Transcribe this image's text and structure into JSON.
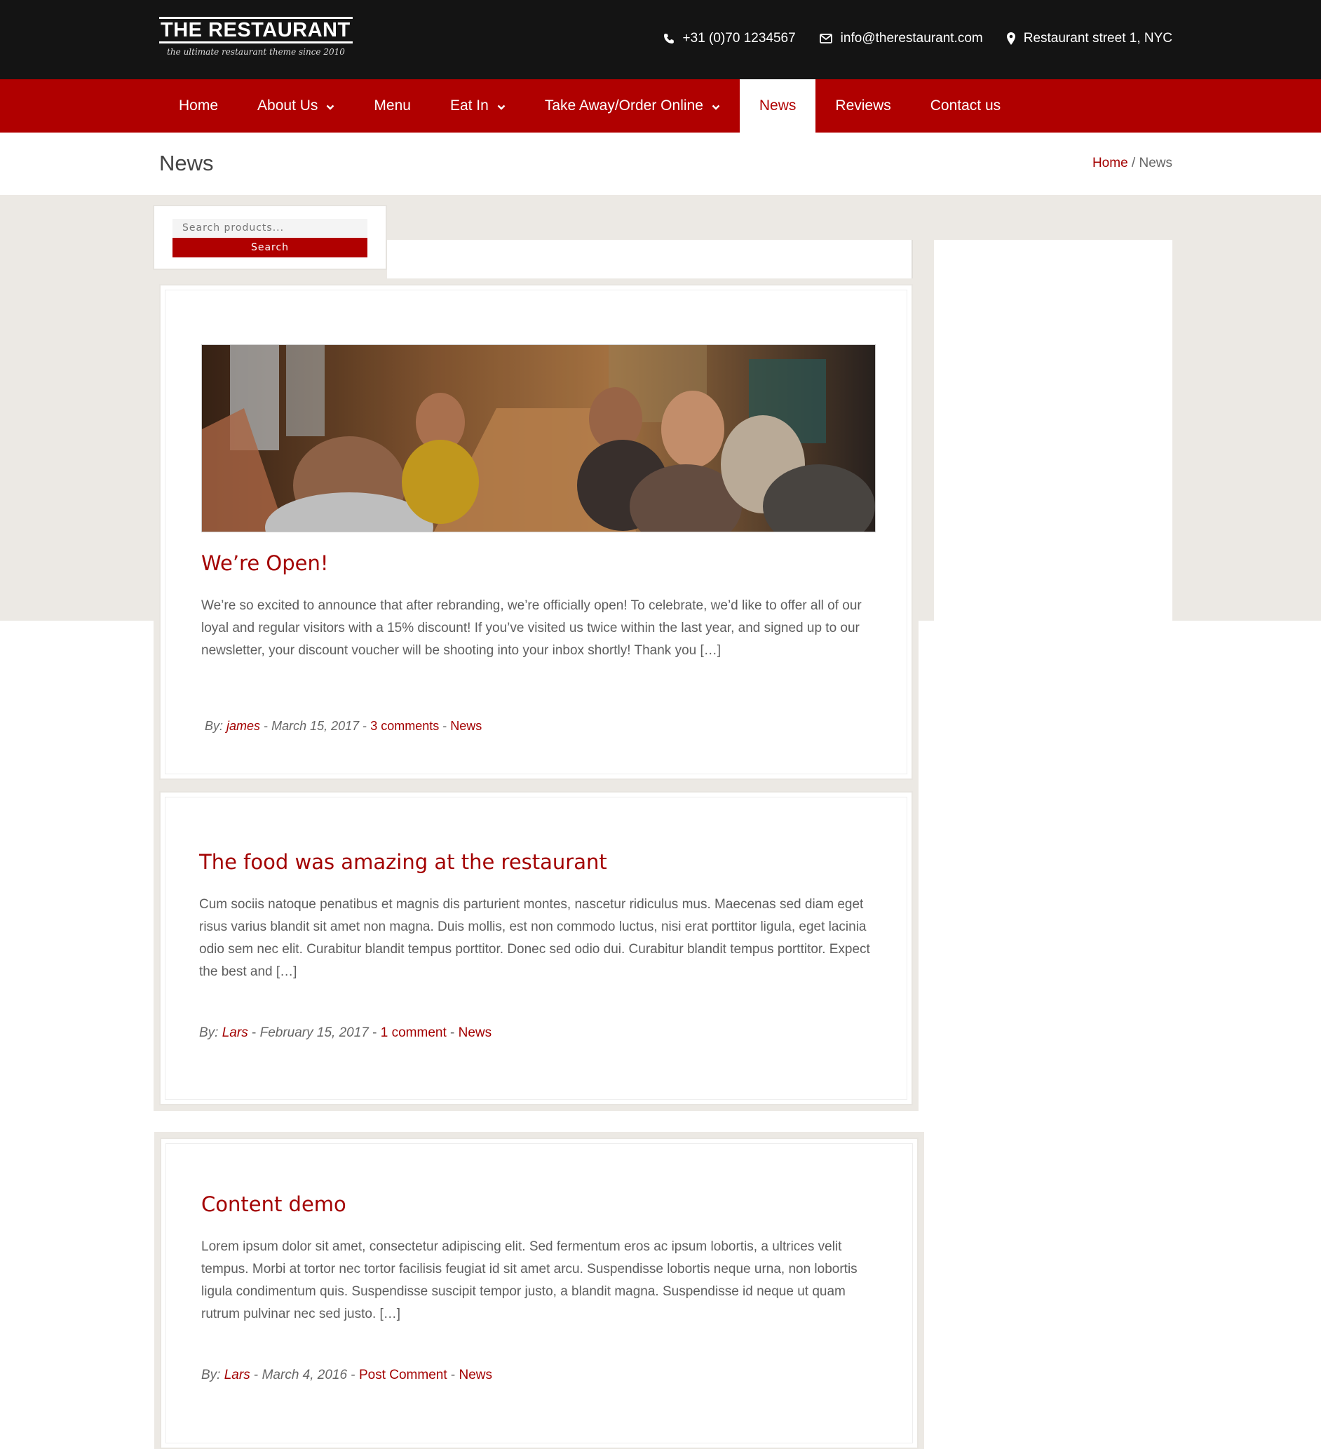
{
  "header": {
    "logo_title": "THE RESTAURANT",
    "logo_tagline": "the ultimate restaurant theme since 2010",
    "phone": "+31 (0)70 1234567",
    "email": "info@therestaurant.com",
    "address": "Restaurant street 1, NYC"
  },
  "nav": {
    "items": [
      {
        "label": "Home"
      },
      {
        "label": "About Us"
      },
      {
        "label": "Menu"
      },
      {
        "label": "Eat In"
      },
      {
        "label": "Take Away/Order Online"
      },
      {
        "label": "News"
      },
      {
        "label": "Reviews"
      },
      {
        "label": "Contact us"
      }
    ]
  },
  "page": {
    "title": "News",
    "breadcrumb_home": "Home",
    "breadcrumb_sep": "/",
    "breadcrumb_current": "News"
  },
  "search": {
    "placeholder": "Search products...",
    "button_label": "Search"
  },
  "posts": [
    {
      "title": "We’re Open!",
      "excerpt": "We’re so excited to announce that after rebranding, we’re officially open! To celebrate, we’d like to offer all of our loyal and regular visitors with a 15% discount! If you’ve visited us twice within the last year, and signed up to our newsletter, your discount voucher will be shooting into your inbox shortly! Thank you […]",
      "by_label": "By:",
      "author": "james",
      "date": "March 15, 2017",
      "comments": "3 comments",
      "category": "News"
    },
    {
      "title": "The food was amazing at the restaurant",
      "excerpt": "Cum sociis natoque penatibus et magnis dis parturient montes, nascetur ridiculus mus. Maecenas sed diam eget risus varius blandit sit amet non magna. Duis mollis, est non commodo luctus, nisi erat porttitor ligula, eget lacinia odio sem nec elit. Curabitur blandit tempus porttitor. Donec sed odio dui. Curabitur blandit tempus porttitor. Expect the best and […]",
      "by_label": "By:",
      "author": "Lars",
      "date": "February 15, 2017",
      "comments": "1 comment",
      "category": "News"
    },
    {
      "title": "Content demo",
      "excerpt": "Lorem ipsum dolor sit amet, consectetur adipiscing elit. Sed fermentum eros ac ipsum lobortis, a ultrices velit tempus. Morbi at tortor nec tortor facilisis feugiat id sit amet arcu. Suspendisse lobortis neque urna, non lobortis ligula condimentum quis. Suspendisse suscipit tempor justo, a blandit magna. Suspendisse id neque ut quam rutrum pulvinar nec sed justo. […]",
      "by_label": "By:",
      "author": "Lars",
      "date": "March 4, 2016",
      "comments": "Post Comment",
      "category": "News"
    }
  ],
  "colors": {
    "brand_red": "#b00000",
    "link_red": "#a30000",
    "topbar": "#141414",
    "band": "#ece9e4"
  },
  "icons": [
    "phone-icon",
    "envelope-icon",
    "map-pin-icon",
    "chevron-down-icon"
  ]
}
